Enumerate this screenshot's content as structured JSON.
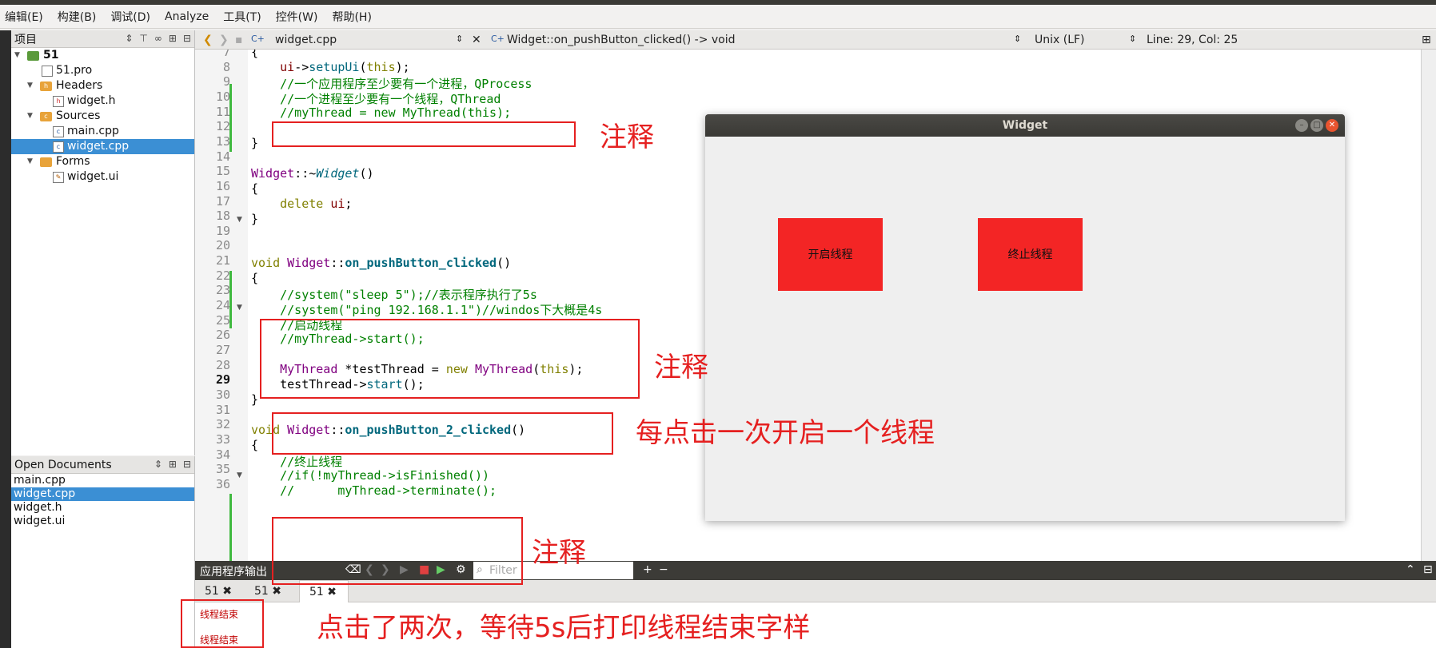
{
  "menubar": {
    "items": [
      "编辑(E)",
      "构建(B)",
      "调试(D)",
      "Analyze",
      "工具(T)",
      "控件(W)",
      "帮助(H)"
    ]
  },
  "projects_panel": {
    "title": "项目",
    "tree": [
      {
        "label": "51",
        "bold": true
      },
      {
        "label": "51.pro"
      },
      {
        "label": "Headers"
      },
      {
        "label": "widget.h"
      },
      {
        "label": "Sources"
      },
      {
        "label": "main.cpp"
      },
      {
        "label": "widget.cpp",
        "selected": true
      },
      {
        "label": "Forms"
      },
      {
        "label": "widget.ui"
      }
    ]
  },
  "open_documents": {
    "title": "Open Documents",
    "docs": [
      "main.cpp",
      "widget.cpp",
      "widget.h",
      "widget.ui"
    ],
    "selected_index": 1
  },
  "editor_toolbar": {
    "file": "widget.cpp",
    "symbol": "Widget::on_pushButton_clicked() -> void",
    "line_ending": "Unix (LF)",
    "position": "Line: 29, Col: 25"
  },
  "editor": {
    "current_line": 29,
    "line_numbers": [
      "7",
      "8",
      "9",
      "10",
      "11",
      "12",
      "13",
      "14",
      "15",
      "16",
      "17",
      "18",
      "19",
      "20",
      "21",
      "22",
      "23",
      "24",
      "25",
      "26",
      "27",
      "28",
      "29",
      "30",
      "31",
      "32",
      "33",
      "34",
      "35",
      "36"
    ]
  },
  "output_pane": {
    "title": "应用程序输出",
    "filter_placeholder": "Filter",
    "tabs": [
      "51",
      "51",
      "51"
    ],
    "lines": [
      "线程结束",
      "线程结束"
    ]
  },
  "widget_window": {
    "title": "Widget",
    "start_button": "开启线程",
    "stop_button": "终止线程"
  },
  "annotations": {
    "a1": "注释",
    "a2": "注释",
    "a3": "每点击一次开启一个线程",
    "a4": "注释",
    "a5": "点击了两次，等待5s后打印线程结束字样"
  },
  "colors": {
    "annotation_red": "#e52020",
    "button_red": "#f32525",
    "selection_blue": "#3b8fd4"
  }
}
